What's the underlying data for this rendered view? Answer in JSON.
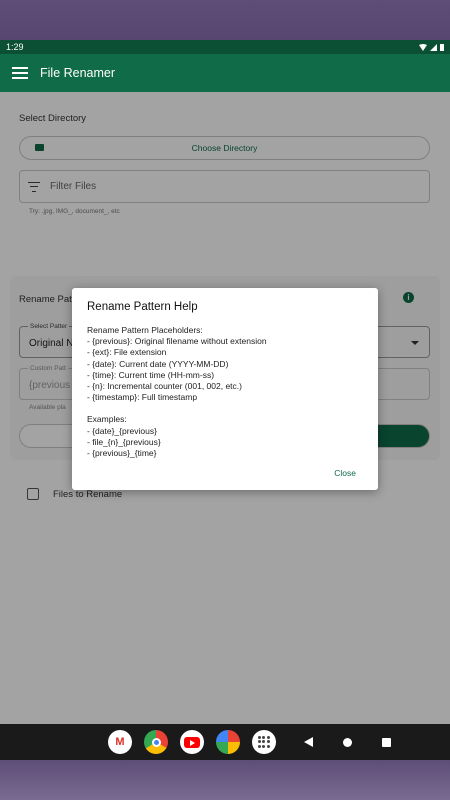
{
  "status_bar": {
    "time": "1:29"
  },
  "app_bar": {
    "title": "File Renamer"
  },
  "directory": {
    "section_label": "Select Directory",
    "choose_label": "Choose Directory"
  },
  "filter": {
    "placeholder": "Filter Files",
    "hint": "Try: .jpg, IMG_, document_, etc"
  },
  "pattern_card": {
    "label": "Rename Patt",
    "select_floating_label": "Select Patter",
    "select_value": "Original N",
    "custom_floating_label": "Custom Patt",
    "custom_value": "{previous",
    "available_hint": "Available pla"
  },
  "files": {
    "label": "Files to Rename"
  },
  "dialog": {
    "title": "Rename Pattern Help",
    "placeholders_heading": "Rename Pattern Placeholders:",
    "placeholders": [
      "- {previous}: Original filename without extension",
      "- {ext}: File extension",
      "- {date}: Current date (YYYY-MM-DD)",
      "- {time}: Current time (HH-mm-ss)",
      "- {n}: Incremental counter (001, 002, etc.)",
      "- {timestamp}: Full timestamp"
    ],
    "examples_heading": "Examples:",
    "examples": [
      "- {date}_{previous}",
      "- file_{n}_{previous}",
      "- {previous}_{time}"
    ],
    "close_label": "Close"
  },
  "icons": {
    "menu": "menu-icon",
    "folder": "folder-icon",
    "filter": "filter-icon",
    "info": "info-icon",
    "dropdown": "chevron-down-icon"
  },
  "colors": {
    "primary": "#0f6b48",
    "status_bar": "#0b4f35"
  }
}
